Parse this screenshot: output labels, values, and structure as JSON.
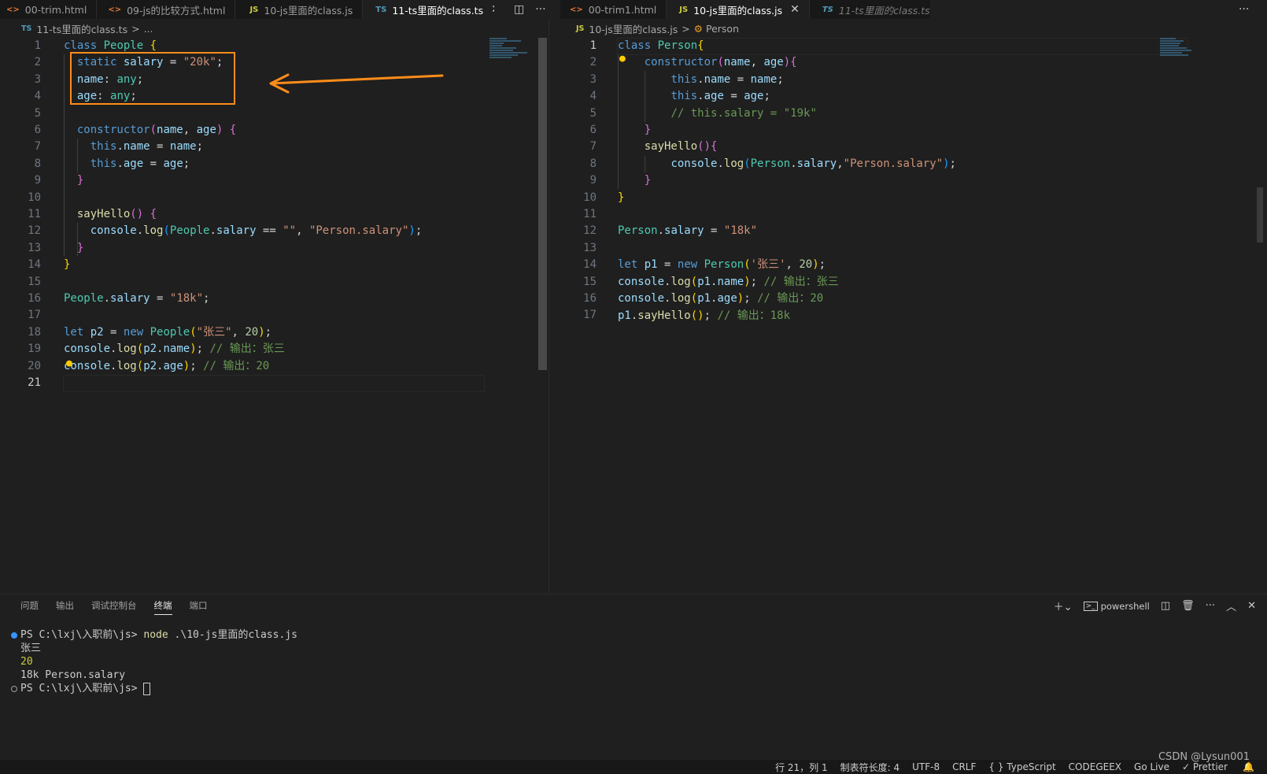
{
  "left_group": {
    "tabs": [
      {
        "icon": "<>",
        "icon_kind": "html",
        "label": "00-trim.html",
        "state": "normal"
      },
      {
        "icon": "<>",
        "icon_kind": "html",
        "label": "09-js的比较方式.html",
        "state": "normal"
      },
      {
        "icon": "JS",
        "icon_kind": "js",
        "label": "10-js里面的class.js",
        "state": "normal"
      },
      {
        "icon": "TS",
        "icon_kind": "ts",
        "label": "11-ts里面的class.ts",
        "state": "active"
      }
    ],
    "breadcrumb": {
      "icon": "TS",
      "file": "11-ts里面的class.ts",
      "sep": ">",
      "rest": "..."
    },
    "current_line": 21
  },
  "right_group": {
    "tabs": [
      {
        "icon": "<>",
        "icon_kind": "html",
        "label": "00-trim1.html",
        "state": "normal"
      },
      {
        "icon": "JS",
        "icon_kind": "js",
        "label": "10-js里面的class.js",
        "state": "active"
      },
      {
        "icon": "TS",
        "icon_kind": "ts",
        "label": "11-ts里面的class.ts",
        "state": "preview"
      }
    ],
    "breadcrumb": {
      "icon": "JS",
      "file": "10-js里面的class.js",
      "sep": ">",
      "symbol": "Person"
    },
    "current_line": 1
  },
  "tab_actions": {
    "split": "◫",
    "more": "···"
  },
  "panel": {
    "tabs": [
      "问题",
      "输出",
      "调试控制台",
      "终端",
      "端口"
    ],
    "active_tab": "终端",
    "shell": "powershell",
    "terminal_lines": [
      {
        "prompt": "PS C:\\lxj\\入职前\\js> ",
        "cmd": "node",
        "args": " .\\10-js里面的class.js",
        "dot": "#3794ff"
      },
      {
        "text": "张三"
      },
      {
        "text": "20",
        "color": "#cbcb41"
      },
      {
        "text": "18k Person.salary"
      },
      {
        "prompt": "PS C:\\lxj\\入职前\\js> ",
        "cursor": true,
        "dot": "#9d9d9d"
      }
    ]
  },
  "status_bar": [
    "行 21，列 1",
    "制表符长度: 4",
    "UTF-8",
    "CRLF",
    "{ } TypeScript",
    "CODEGEEX",
    "Go Live",
    "✓ Prettier"
  ],
  "watermark": "CSDN @Lysun001"
}
